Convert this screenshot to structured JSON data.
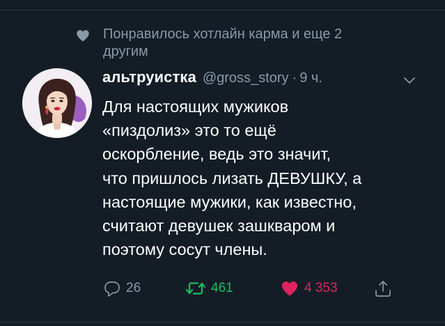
{
  "context": {
    "icon": "heart-icon",
    "text": "Понравилось хотлайн карма и еще 2 другим"
  },
  "tweet": {
    "display_name": "альтруистка",
    "handle": "@gross_story",
    "separator": "·",
    "time": "9 ч.",
    "avatar_icon": "avatar-photo",
    "menu_icon": "chevron-down-icon",
    "text": "Для настоящих мужиков\n«пиздолиз» это то ещё\nоскорбление, ведь это значит,\nчто пришлось лизать ДЕВУШКУ, а\nнастоящие мужики, как известно,\nсчитают девушек зашкваром и\nпоэтому сосут члены."
  },
  "actions": {
    "replies": "26",
    "retweets": "461",
    "likes": "4 353",
    "reply_icon": "reply-icon",
    "retweet_icon": "retweet-icon",
    "like_icon": "heart-filled-icon",
    "share_icon": "share-icon"
  },
  "colors": {
    "background": "#141d26",
    "secondary_text": "#8899a6",
    "primary_text": "#ffffff",
    "retweet_green": "#17bf63",
    "like_red": "#e0245e"
  }
}
